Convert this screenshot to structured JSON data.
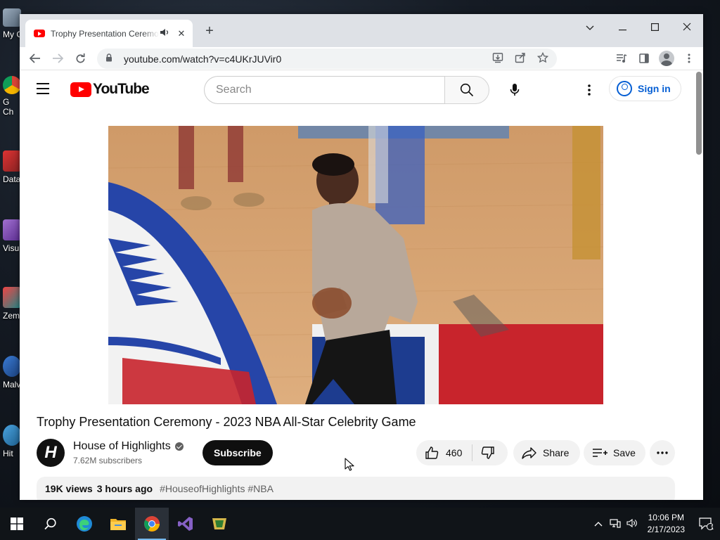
{
  "desktop": {
    "icons": [
      {
        "label": "My C"
      },
      {
        "label": "G\nCh"
      },
      {
        "label": "Data"
      },
      {
        "label": "Visu"
      },
      {
        "label": "Zem"
      },
      {
        "label": "Malv"
      },
      {
        "label": "Hit"
      }
    ]
  },
  "browser": {
    "tab": {
      "title": "Trophy Presentation Ceremony - 2023 NBA All-Star Celebrity Game"
    },
    "url": "youtube.com/watch?v=c4UKrJUVir0"
  },
  "youtube": {
    "logo_text": "YouTube",
    "search": {
      "placeholder": "Search"
    },
    "sign_in": "Sign in",
    "video": {
      "title": "Trophy Presentation Ceremony - 2023 NBA All-Star Celebrity Game",
      "channel": "House of Highlights",
      "subscribers": "7.62M subscribers",
      "subscribe_label": "Subscribe",
      "likes": "460",
      "share_label": "Share",
      "save_label": "Save",
      "views": "19K views",
      "age": "3 hours ago",
      "tags": "#HouseofHighlights #NBA"
    }
  },
  "taskbar": {
    "time": "10:06 PM",
    "date": "2/17/2023",
    "notification_count": "1"
  }
}
